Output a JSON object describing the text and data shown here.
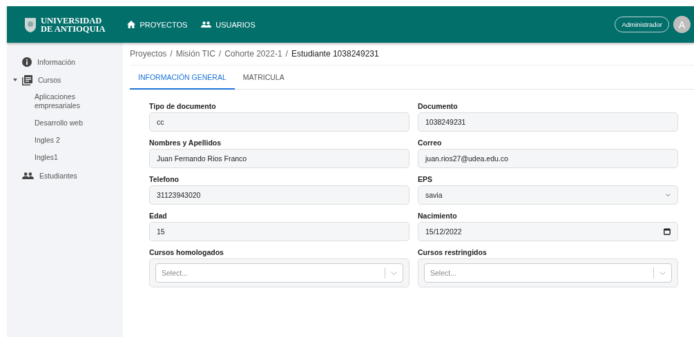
{
  "header": {
    "logo_lines": [
      "UNIVERSIDAD",
      "DE ANTIOQUIA"
    ],
    "nav": [
      {
        "label": "PROYECTOS"
      },
      {
        "label": "USUARIOS"
      }
    ],
    "role": "Administrador",
    "avatar": "A"
  },
  "sidebar": {
    "items": [
      {
        "label": "Información"
      },
      {
        "label": "Cursos",
        "expanded": true,
        "children": [
          {
            "label": "Aplicaciones empresariales"
          },
          {
            "label": "Desarrollo web"
          },
          {
            "label": "Ingles 2"
          },
          {
            "label": "Ingles1"
          }
        ]
      },
      {
        "label": "Estudiantes"
      }
    ]
  },
  "breadcrumb": {
    "separator": "/",
    "items": [
      "Proyectos",
      "Misión TIC",
      "Cohorte 2022-1"
    ],
    "current": "Estudiante 1038249231"
  },
  "tabs": [
    {
      "label": "INFORMACIÓN GENERAL",
      "selected": true
    },
    {
      "label": "MATRICULA",
      "selected": false
    }
  ],
  "form": {
    "fields": [
      {
        "label": "Tipo de documento",
        "kind": "text",
        "value": "cc"
      },
      {
        "label": "Documento",
        "kind": "text",
        "value": "1038249231"
      },
      {
        "label": "Nombres y Apellidos",
        "kind": "text",
        "value": "Juan Fernando Rios Franco"
      },
      {
        "label": "Correo",
        "kind": "text",
        "value": "juan.rios27@udea.edu.co"
      },
      {
        "label": "Telefono",
        "kind": "text",
        "value": "31123943020"
      },
      {
        "label": "EPS",
        "kind": "select",
        "value": "savia"
      },
      {
        "label": "Edad",
        "kind": "text",
        "value": "15"
      },
      {
        "label": "Nacimiento",
        "kind": "date",
        "value": "15/12/2022"
      },
      {
        "label": "Cursos homologados",
        "kind": "multiselect",
        "placeholder": "Select..."
      },
      {
        "label": "Cursos restringidos",
        "kind": "multiselect",
        "placeholder": "Select..."
      }
    ]
  }
}
